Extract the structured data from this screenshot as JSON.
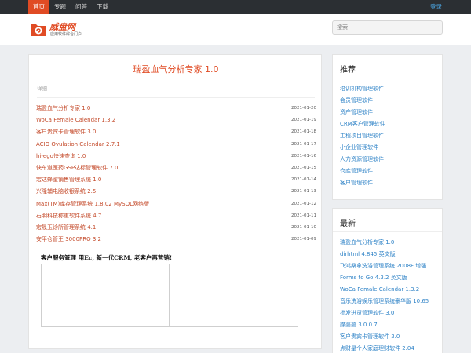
{
  "nav": {
    "items": [
      "首页",
      "专题",
      "问答",
      "下载"
    ],
    "login": "登录"
  },
  "header": {
    "logo_text": "威盘网",
    "logo_sub": "应用软件综合门户",
    "search_placeholder": "搜索",
    "colors": {
      "accent": "#e04b24",
      "topbar": "#2b2f33",
      "link": "#2f83c7"
    }
  },
  "main": {
    "title": "瑞盈血气分析专家 1.0",
    "detail_label": "详细",
    "list": [
      {
        "name": "瑞盈血气分析专家 1.0",
        "date": "2021-01-20"
      },
      {
        "name": "WoCa Female Calendar 1.3.2",
        "date": "2021-01-19"
      },
      {
        "name": "客户贵宾卡管理软件 3.0",
        "date": "2021-01-18"
      },
      {
        "name": "ACIO Ovulation Calendar 2.7.1",
        "date": "2021-01-17"
      },
      {
        "name": "hi-ego快速查询 1.0",
        "date": "2021-01-16"
      },
      {
        "name": "快车道医药GSP达标管理软件 7.0",
        "date": "2021-01-15"
      },
      {
        "name": "宏达蜂蜜销售管理系统 1.0",
        "date": "2021-01-14"
      },
      {
        "name": "兴隆辅电脑收银系统 2.5",
        "date": "2021-01-13"
      },
      {
        "name": "Max(TM)库存管理系统 1.8.02 MySQL网络版",
        "date": "2021-01-12"
      },
      {
        "name": "石明科技称重软件系统 4.7",
        "date": "2021-01-11"
      },
      {
        "name": "宏晟玉诊所管理系统 4.1",
        "date": "2021-01-10"
      },
      {
        "name": "安平仓管王 3000PRO 3.2",
        "date": "2021-01-09"
      }
    ],
    "ad_text": "客户服务管理 用Ec, 新一代CRM, 老客户再营销!"
  },
  "sidebar": {
    "recommend": {
      "title": "推荐",
      "items": [
        "培训机构管理软件",
        "会员管理软件",
        "资产管理软件",
        "CRM客户管理软件",
        "工程项目管理软件",
        "小企业管理软件",
        "人力资源管理软件",
        "仓库管理软件",
        "客户管理软件"
      ]
    },
    "latest": {
      "title": "最新",
      "items": [
        "瑞盈血气分析专家 1.0",
        "dirhtml 4.845 英文版",
        "飞鸿桑拿洗浴管理系统 2008F  增强",
        "Forms to Go 4.3.2 英文版",
        "WoCa Female Calendar 1.3.2",
        "音乐洗浴娱乐管理系统豪华版 10.65",
        "批发进货管理软件 3.0",
        "媒婆婆 3.0.0.7",
        "客户贵宾卡管理软件 3.0",
        "点财星个人家庭理财软件 2.04"
      ]
    }
  }
}
